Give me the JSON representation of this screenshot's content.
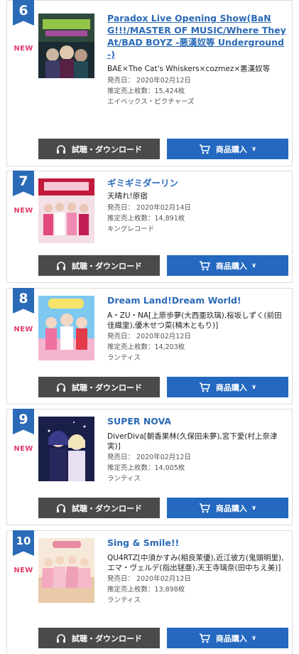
{
  "colors": {
    "accent": "#2a6ab7",
    "new": "#e23c6a",
    "download_btn": "#4a4a4a",
    "buy_btn": "#2468c0"
  },
  "labels": {
    "new": "NEW",
    "download": "試聴・ダウンロード",
    "buy": "商品購入",
    "release_prefix": "発売日：",
    "sales_prefix": "推定売上枚数："
  },
  "items": [
    {
      "rank": "6",
      "title": "Paradox Live Opening Show(BaNG!!!/MASTER OF MUSIC/Where They At/BAD BOYZ -悪漢奴等 Underground-)",
      "artist": "BAE×The Cat's Whiskers×cozmez×悪漢奴等",
      "release": "2020年02月12日",
      "sales": "15,424枚",
      "label": "エイベックス・ピクチャーズ"
    },
    {
      "rank": "7",
      "title": "ギミギミダーリン",
      "artist": "天晴れ!原宿",
      "release": "2020年02月14日",
      "sales": "14,891枚",
      "label": "キングレコード"
    },
    {
      "rank": "8",
      "title": "Dream Land!Dream World!",
      "artist": "A・ZU・NA[上原歩夢(大西亜玖璃),桜坂しずく(前田佳織里),優木せつ菜(楠木ともり)]",
      "release": "2020年02月12日",
      "sales": "14,203枚",
      "label": "ランティス"
    },
    {
      "rank": "9",
      "title": "SUPER NOVA",
      "artist": "DiverDiva[朝香果林(久保田未夢),宮下愛(村上奈津実)]",
      "release": "2020年02月12日",
      "sales": "14,005枚",
      "label": "ランティス"
    },
    {
      "rank": "10",
      "title": "Sing & Smile!!",
      "artist": "QU4RTZ[中須かすみ(相良茉優),近江彼方(鬼頭明里),エマ・ヴェルデ(指出毬亜),天王寺璃奈(田中ちえ美)]",
      "release": "2020年02月12日",
      "sales": "13,898枚",
      "label": "ランティス"
    }
  ]
}
